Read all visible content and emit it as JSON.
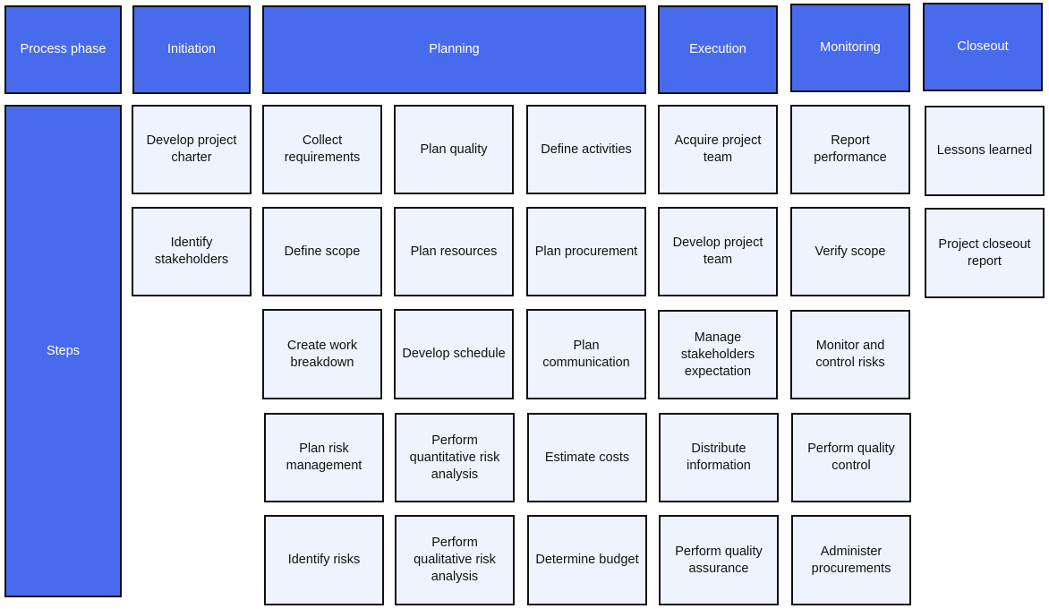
{
  "colors": {
    "phase": "#486aec",
    "step": "#eef3fe",
    "border": "#111111"
  },
  "header": {
    "row_label": "Process phase",
    "phases": [
      "Initiation",
      "Planning",
      "Execution",
      "Monitoring",
      "Closeout"
    ]
  },
  "steps_label": "Steps",
  "steps": {
    "initiation": [
      "Develop project charter",
      "Identify stakeholders"
    ],
    "planning": [
      "Collect requirements",
      "Plan quality",
      "Define activities",
      "Define scope",
      "Plan resources",
      "Plan procurement",
      "Create work breakdown",
      "Develop schedule",
      "Plan communication",
      "Plan risk management",
      "Perform quantitative risk analysis",
      "Estimate costs",
      "Identify risks",
      "Perform qualitative risk analysis",
      "Determine budget"
    ],
    "execution": [
      "Acquire project team",
      "Develop project team",
      "Manage stakeholders expectation",
      "Distribute information",
      "Perform quality assurance"
    ],
    "monitoring": [
      "Report performance",
      "Verify scope",
      "Monitor and control risks",
      "Perform quality control",
      "Administer procurements"
    ],
    "closeout": [
      "Lessons learned",
      "Project closeout report"
    ]
  }
}
